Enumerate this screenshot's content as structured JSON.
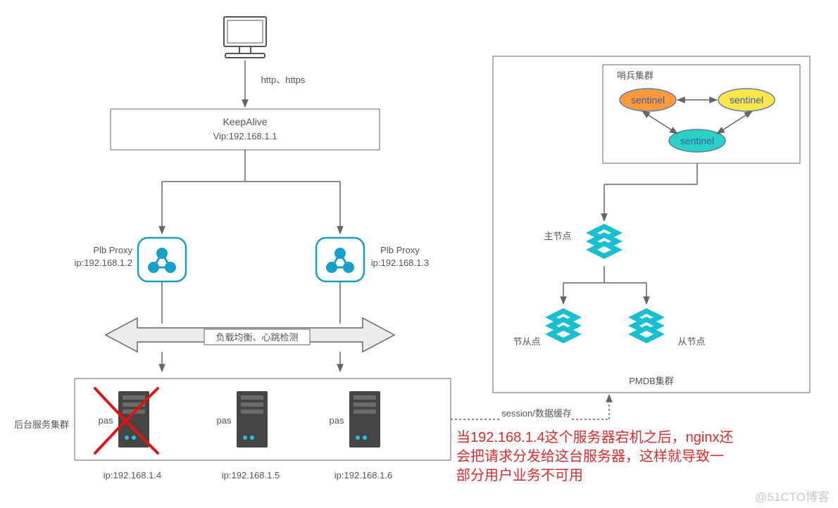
{
  "client": {
    "protocol": "http、https"
  },
  "keepalive": {
    "title": "KeepAlive",
    "vip": "Vip:192.168.1.1"
  },
  "proxies": [
    {
      "name": "Plb Proxy",
      "ip": "ip:192.168.1.2"
    },
    {
      "name": "Plb Proxy",
      "ip": "ip:192.168.1.3"
    }
  ],
  "balance_label": "负载均衡、心跳检测",
  "backend": {
    "title": "后台服务集群",
    "servers": [
      {
        "label": "pas",
        "ip": "ip:192.168.1.4",
        "down": true
      },
      {
        "label": "pas",
        "ip": "ip:192.168.1.5",
        "down": false
      },
      {
        "label": "pas",
        "ip": "ip:192.168.1.6",
        "down": false
      }
    ]
  },
  "session_label": "session/数据缓存",
  "pmdb": {
    "title": "PMDB集群",
    "sentinel_box": "哨兵集群",
    "sentinels": [
      "sentinel",
      "sentinel",
      "sentinel"
    ],
    "master": "主节点",
    "slaves": [
      "节从点",
      "从节点"
    ]
  },
  "note": {
    "l1": "当192.168.1.4这个服务器宕机之后，nginx还",
    "l2": "会把请求分发给这台服务器，这样就导致一",
    "l3": "部分用户业务不可用"
  },
  "watermark": "@51CTO博客"
}
